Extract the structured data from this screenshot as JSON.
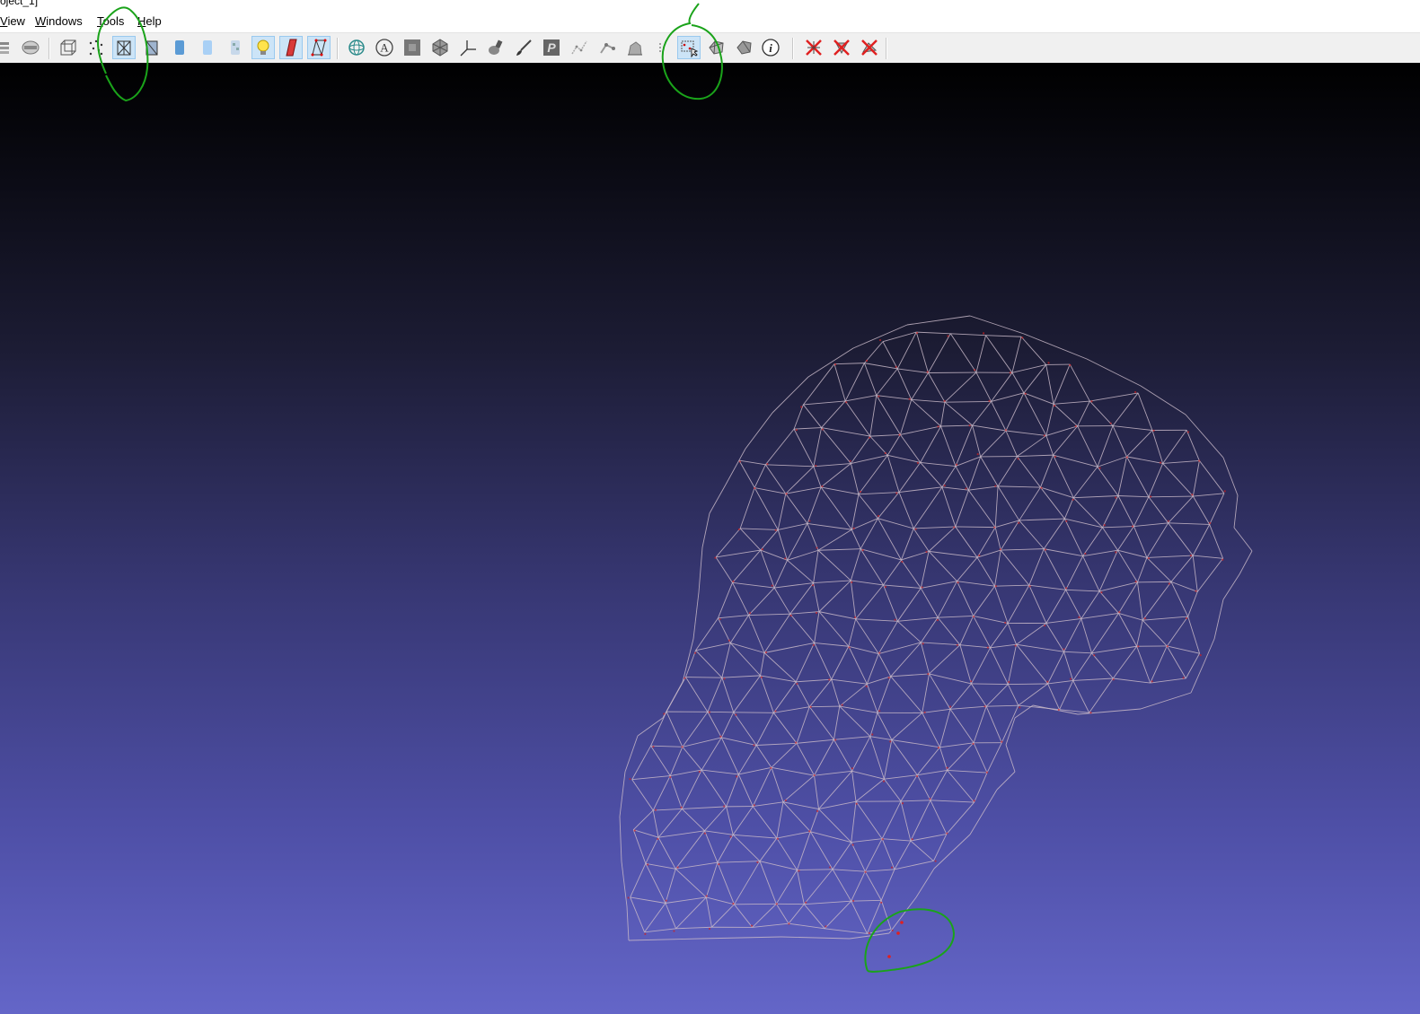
{
  "window": {
    "title_fragment": "oject_1]"
  },
  "menu": [
    {
      "label": "View",
      "accel": "V"
    },
    {
      "label": "Windows",
      "accel": "W"
    },
    {
      "label": "Tools",
      "accel": "T"
    },
    {
      "label": "Help",
      "accel": "H"
    }
  ],
  "toolbar": {
    "buttons": [
      {
        "icon": "layers-icon",
        "active": false
      },
      {
        "icon": "snapshot-icon",
        "active": false
      },
      {
        "icon": "bounding-box-icon",
        "active": false
      },
      {
        "icon": "points-icon",
        "active": false
      },
      {
        "icon": "wireframe-icon",
        "active": true
      },
      {
        "icon": "hidden-lines-icon",
        "active": false
      },
      {
        "icon": "flat-shading-icon",
        "active": false
      },
      {
        "icon": "smooth-shading-icon",
        "active": false
      },
      {
        "icon": "texture-icon",
        "active": false
      },
      {
        "icon": "light-bulb-icon",
        "active": true
      },
      {
        "icon": "double-side-lighting-icon",
        "active": true
      },
      {
        "icon": "show-vertices-icon",
        "active": true
      },
      {
        "icon": "trackball-icon",
        "active": false
      },
      {
        "icon": "label-icon",
        "active": false
      },
      {
        "icon": "quoted-box-icon",
        "active": false
      },
      {
        "icon": "selection-fill-icon",
        "active": false
      },
      {
        "icon": "axis-icon",
        "active": false
      },
      {
        "icon": "color-paint-icon",
        "active": false
      },
      {
        "icon": "brush-icon",
        "active": false
      },
      {
        "icon": "parameterization-icon",
        "active": false
      },
      {
        "icon": "align-icon",
        "active": false
      },
      {
        "icon": "pick-points-icon",
        "active": false
      },
      {
        "icon": "measure-icon",
        "active": false
      },
      {
        "icon": "reference-icon",
        "active": false
      },
      {
        "icon": "select-vertices-icon",
        "active": true
      },
      {
        "icon": "select-faces-icon",
        "active": false
      },
      {
        "icon": "select-connected-icon",
        "active": false
      },
      {
        "icon": "info-icon",
        "active": false
      },
      {
        "icon": "delete-vertices-icon",
        "active": false
      },
      {
        "icon": "delete-faces-icon",
        "active": false
      },
      {
        "icon": "delete-faces-vertices-icon",
        "active": false
      }
    ]
  },
  "viewport": {
    "background_top": "#000000",
    "background_bottom": "#6466c8",
    "mesh_edge_color": "#c8b8c8",
    "mesh_vertex_color": "#d02020"
  },
  "annotations": {
    "circle_color": "#1aa31a"
  }
}
